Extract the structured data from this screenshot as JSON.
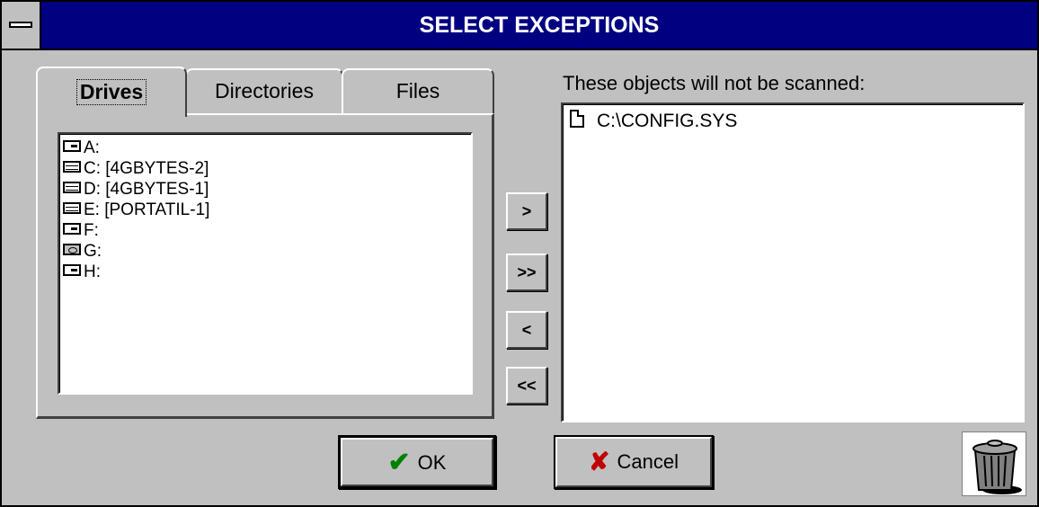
{
  "window": {
    "title": "SELECT EXCEPTIONS"
  },
  "tabs": [
    {
      "label": "Drives",
      "active": true
    },
    {
      "label": "Directories",
      "active": false
    },
    {
      "label": "Files",
      "active": false
    }
  ],
  "drives": [
    {
      "label": "A:",
      "icon": "floppy-drive-icon"
    },
    {
      "label": "C: [4GBYTES-2]",
      "icon": "hard-drive-icon"
    },
    {
      "label": "D: [4GBYTES-1]",
      "icon": "hard-drive-icon"
    },
    {
      "label": "E: [PORTATIL-1]",
      "icon": "hard-drive-icon"
    },
    {
      "label": "F:",
      "icon": "floppy-drive-icon"
    },
    {
      "label": "G:",
      "icon": "cdrom-drive-icon"
    },
    {
      "label": "H:",
      "icon": "floppy-drive-icon"
    }
  ],
  "transfer": {
    "add_label": ">",
    "add_all_label": ">>",
    "remove_label": "<",
    "remove_all_label": "<<"
  },
  "exceptions": {
    "label": "These objects will not be scanned:",
    "items": [
      {
        "label": "C:\\CONFIG.SYS",
        "icon": "file-icon"
      }
    ]
  },
  "buttons": {
    "ok": "OK",
    "cancel": "Cancel"
  },
  "colors": {
    "titlebar": "#000080",
    "face": "#c0c0c0",
    "ok_check": "#008000",
    "cancel_x": "#c00000"
  }
}
